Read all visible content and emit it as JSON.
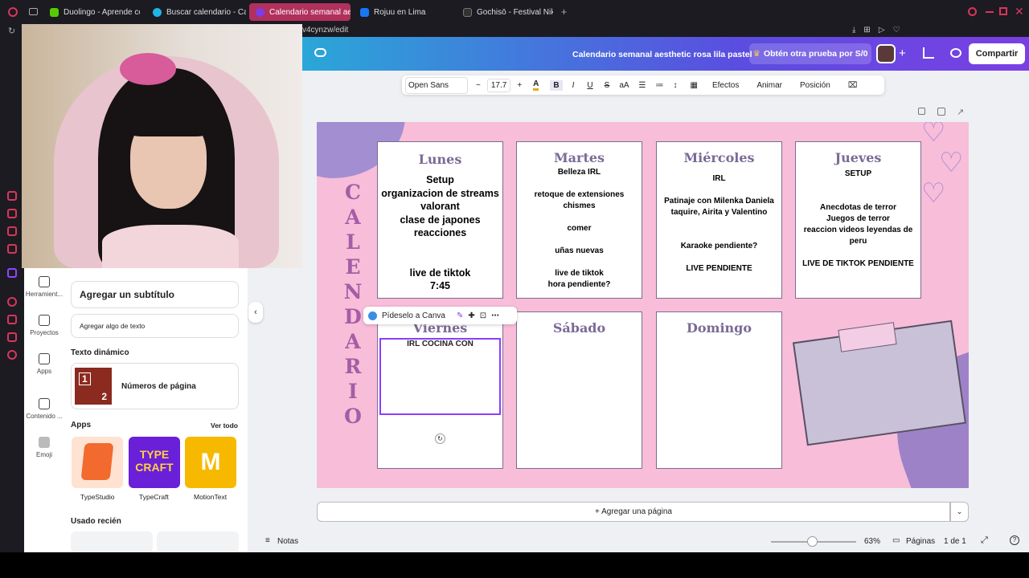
{
  "browser": {
    "tabs": [
      {
        "label": "Duolingo - Aprende con le",
        "color": "#58cc02"
      },
      {
        "label": "Buscar calendario - Canva",
        "color": "#1fb5e8"
      },
      {
        "label": "Calendario semanal aesth",
        "color": "#7d3ce4"
      },
      {
        "label": "Rojuu en Lima",
        "color": "#1877f2"
      },
      {
        "label": "Gochisō - Festival Nikkei",
        "color": "#222222"
      }
    ],
    "url": "v4cynzw/edit"
  },
  "canva": {
    "doc_title": "Calendario semanal aesthetic rosa lila pastel",
    "trial_button": "Obtén otra prueba por S/0",
    "share_button": "Compartir"
  },
  "toolbar": {
    "font": "Open Sans",
    "size": "17.7",
    "effects": "Efectos",
    "animate": "Animar",
    "position": "Posición"
  },
  "panel": {
    "rail": [
      "Herramient...",
      "Proyectos",
      "Apps",
      "Contenido ...",
      "Emoji"
    ],
    "subtitle_button": "Agregar un subtítulo",
    "text_button": "Agregar algo de texto",
    "dynamic_heading": "Texto dinámico",
    "page_numbers": "Números de página",
    "apps_heading": "Apps",
    "see_all": "Ver todo",
    "apps": [
      "TypeStudio",
      "TypeCraft",
      "MotionText"
    ],
    "recent_heading": "Usado recién"
  },
  "calendar": {
    "vertical_title": [
      "C",
      "A",
      "L",
      "E",
      "N",
      "D",
      "A",
      "R",
      "I",
      "O"
    ],
    "days": [
      {
        "name": "Lunes",
        "text": "Setup\norganizacion de streams\nvalorant\nclase de japones\nreacciones\n\n\nlive de tiktok\n7:45"
      },
      {
        "name": "Martes",
        "text": "Belleza IRL\n\nretoque de extensiones\nchismes\n\ncomer\n\nuñas nuevas\n\nlive de tiktok\nhora pendiente?"
      },
      {
        "name": "Miércoles",
        "text": "IRL\n\nPatinaje con Milenka Daniela\ntaquire, Airita y Valentino\n\n\nKaraoke pendiente?\n\nLIVE PENDIENTE"
      },
      {
        "name": "Jueves",
        "text": "SETUP\n\n\nAnecdotas de terror\nJuegos de terror\nreaccion videos leyendas de\nperu\n\nLIVE DE TIKTOK PENDIENTE"
      },
      {
        "name": "Viernes",
        "text": "IRL\n\nCOCINA CON"
      },
      {
        "name": "Sábado",
        "text": ""
      },
      {
        "name": "Domingo",
        "text": ""
      }
    ],
    "context_menu": "Pídeselo a Canva"
  },
  "footer": {
    "add_page": "+ Agregar una página",
    "notes": "Notas",
    "zoom": "63%",
    "pages_label": "Páginas",
    "page_count": "1 de 1"
  }
}
